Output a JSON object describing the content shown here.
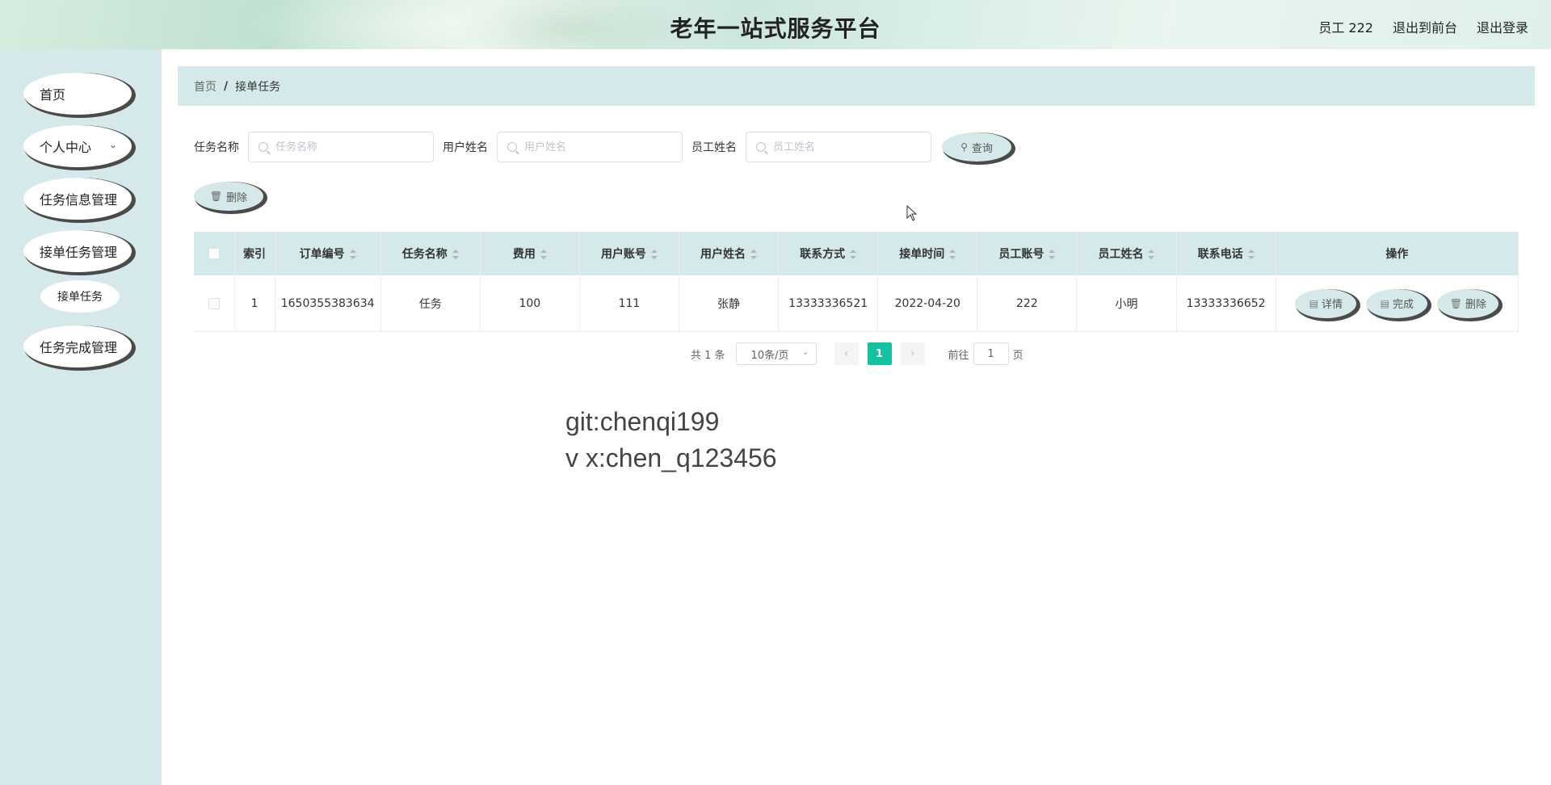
{
  "header": {
    "title": "老年一站式服务平台",
    "user_name": "员工 222",
    "to_front": "退出到前台",
    "logout": "退出登录"
  },
  "sidebar": {
    "items": [
      {
        "label": "首页"
      },
      {
        "label": "个人中心"
      },
      {
        "label": "任务信息管理"
      },
      {
        "label": "接单任务管理"
      },
      {
        "label": "任务完成管理"
      }
    ],
    "submenu": {
      "label": "接单任务"
    }
  },
  "breadcrumb": {
    "home": "首页",
    "separator": "/",
    "current": "接单任务"
  },
  "search": {
    "task_name_label": "任务名称",
    "task_name_placeholder": "任务名称",
    "user_name_label": "用户姓名",
    "user_name_placeholder": "用户姓名",
    "staff_name_label": "员工姓名",
    "staff_name_placeholder": "员工姓名",
    "query_label": "查询"
  },
  "actions": {
    "delete_label": "删除"
  },
  "table": {
    "columns": [
      "索引",
      "订单编号",
      "任务名称",
      "费用",
      "用户账号",
      "用户姓名",
      "联系方式",
      "接单时间",
      "员工账号",
      "员工姓名",
      "联系电话",
      "操作"
    ],
    "rows": [
      {
        "index": "1",
        "order_no": "1650355383634",
        "task_name": "任务",
        "fee": "100",
        "user_account": "111",
        "user_name": "张静",
        "contact": "13333336521",
        "accept_time": "2022-04-20",
        "staff_account": "222",
        "staff_name": "小明",
        "staff_phone": "13333336652"
      }
    ],
    "ops": {
      "detail": "详情",
      "complete": "完成",
      "delete": "删除"
    }
  },
  "pagination": {
    "total": "共 1 条",
    "page_size": "10条/页",
    "current_page": "1",
    "jump_label": "前往",
    "jump_value": "1",
    "jump_suffix": "页"
  },
  "watermark": {
    "line1": "git:chenqi199",
    "line2": "v x:chen_q123456"
  },
  "colors": {
    "accent": "#13c2a0",
    "sidebar_bg": "#d6e9ea",
    "button_shadow": "#4a4a4a"
  }
}
